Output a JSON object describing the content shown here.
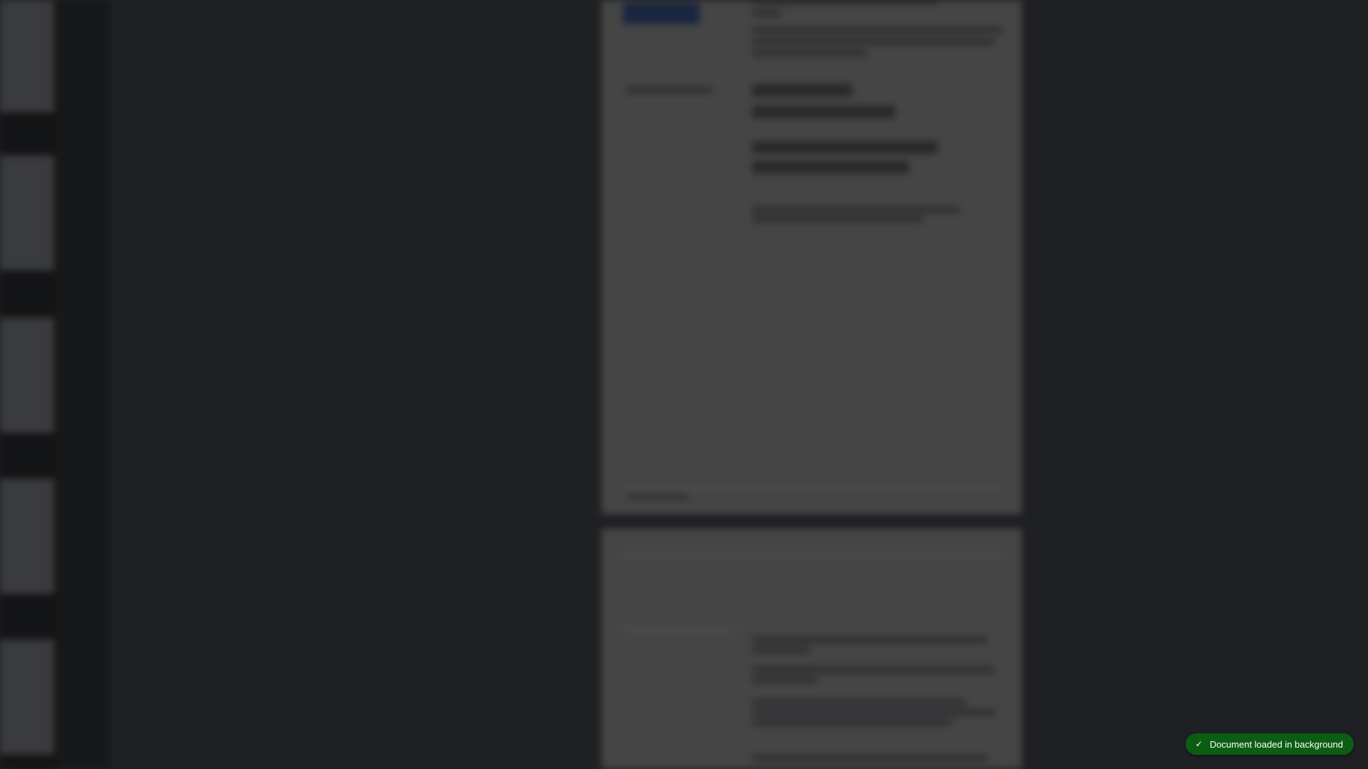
{
  "toast": {
    "icon": "check-icon",
    "glyph": "✓",
    "message": "Document loaded in background",
    "color": "#0b5d14"
  },
  "colors": {
    "background": "#222326",
    "sidebar": "#151617",
    "page": "#4b4b4b",
    "toast": "#0b5d14"
  }
}
